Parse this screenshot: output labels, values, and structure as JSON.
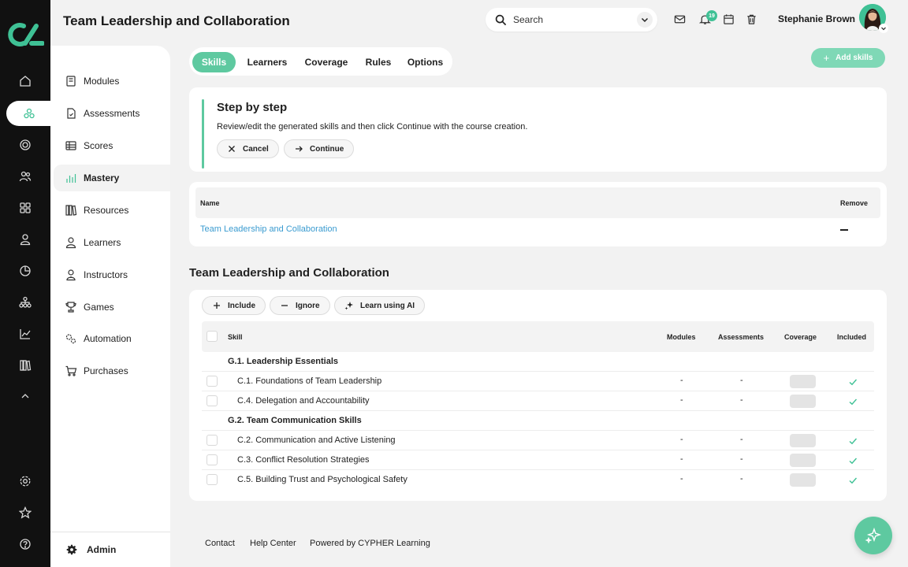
{
  "header": {
    "title": "Team Leadership and Collaboration",
    "search_placeholder": "Search",
    "notification_count": "19",
    "user_name": "Stephanie Brown"
  },
  "rail": {
    "items": [
      "home-icon",
      "skills-icon",
      "target-icon",
      "users-icon",
      "apps-icon",
      "person-icon",
      "pie-chart-icon",
      "org-chart-icon",
      "line-chart-icon",
      "library-icon",
      "chevron-up-icon",
      "settings-icon",
      "star-icon",
      "help-icon"
    ]
  },
  "sidebar": {
    "items": [
      {
        "label": "Modules",
        "icon": "book-icon"
      },
      {
        "label": "Assessments",
        "icon": "document-icon"
      },
      {
        "label": "Scores",
        "icon": "table-icon"
      },
      {
        "label": "Mastery",
        "icon": "bar-chart-icon"
      },
      {
        "label": "Resources",
        "icon": "library-icon"
      },
      {
        "label": "Learners",
        "icon": "person-icon"
      },
      {
        "label": "Instructors",
        "icon": "instructor-icon"
      },
      {
        "label": "Games",
        "icon": "trophy-icon"
      },
      {
        "label": "Automation",
        "icon": "automation-icon"
      },
      {
        "label": "Purchases",
        "icon": "cart-icon"
      }
    ],
    "bottom_label": "Admin"
  },
  "tabs": [
    "Skills",
    "Learners",
    "Coverage",
    "Rules",
    "Options"
  ],
  "add_skills_label": "Add skills",
  "step": {
    "title": "Step by step",
    "text": "Review/edit the generated skills and then click Continue with the course creation.",
    "cancel_label": "Cancel",
    "continue_label": "Continue"
  },
  "name_table": {
    "col_name": "Name",
    "col_remove": "Remove",
    "row_name": "Team Leadership and Collaboration"
  },
  "skills_section": {
    "title": "Team Leadership and Collaboration",
    "include_label": "Include",
    "ignore_label": "Ignore",
    "learn_ai_label": "Learn using AI",
    "columns": [
      "Skill",
      "Modules",
      "Assessments",
      "Coverage",
      "Included"
    ],
    "groups": [
      {
        "label": "G.1. Leadership Essentials",
        "skills": [
          {
            "label": "C.1. Foundations of Team Leadership",
            "modules": "-",
            "assessments": "-"
          },
          {
            "label": "C.4. Delegation and Accountability",
            "modules": "-",
            "assessments": "-"
          }
        ]
      },
      {
        "label": "G.2. Team Communication Skills",
        "skills": [
          {
            "label": "C.2. Communication and Active Listening",
            "modules": "-",
            "assessments": "-"
          },
          {
            "label": "C.3. Conflict Resolution Strategies",
            "modules": "-",
            "assessments": "-"
          },
          {
            "label": "C.5. Building Trust and Psychological Safety",
            "modules": "-",
            "assessments": "-"
          }
        ]
      }
    ]
  },
  "footer": {
    "contact": "Contact",
    "help": "Help Center",
    "powered": "Powered by CYPHER Learning"
  },
  "colors": {
    "accent": "#5ec9a0",
    "rail": "#111111",
    "link": "#3a9bd0"
  }
}
